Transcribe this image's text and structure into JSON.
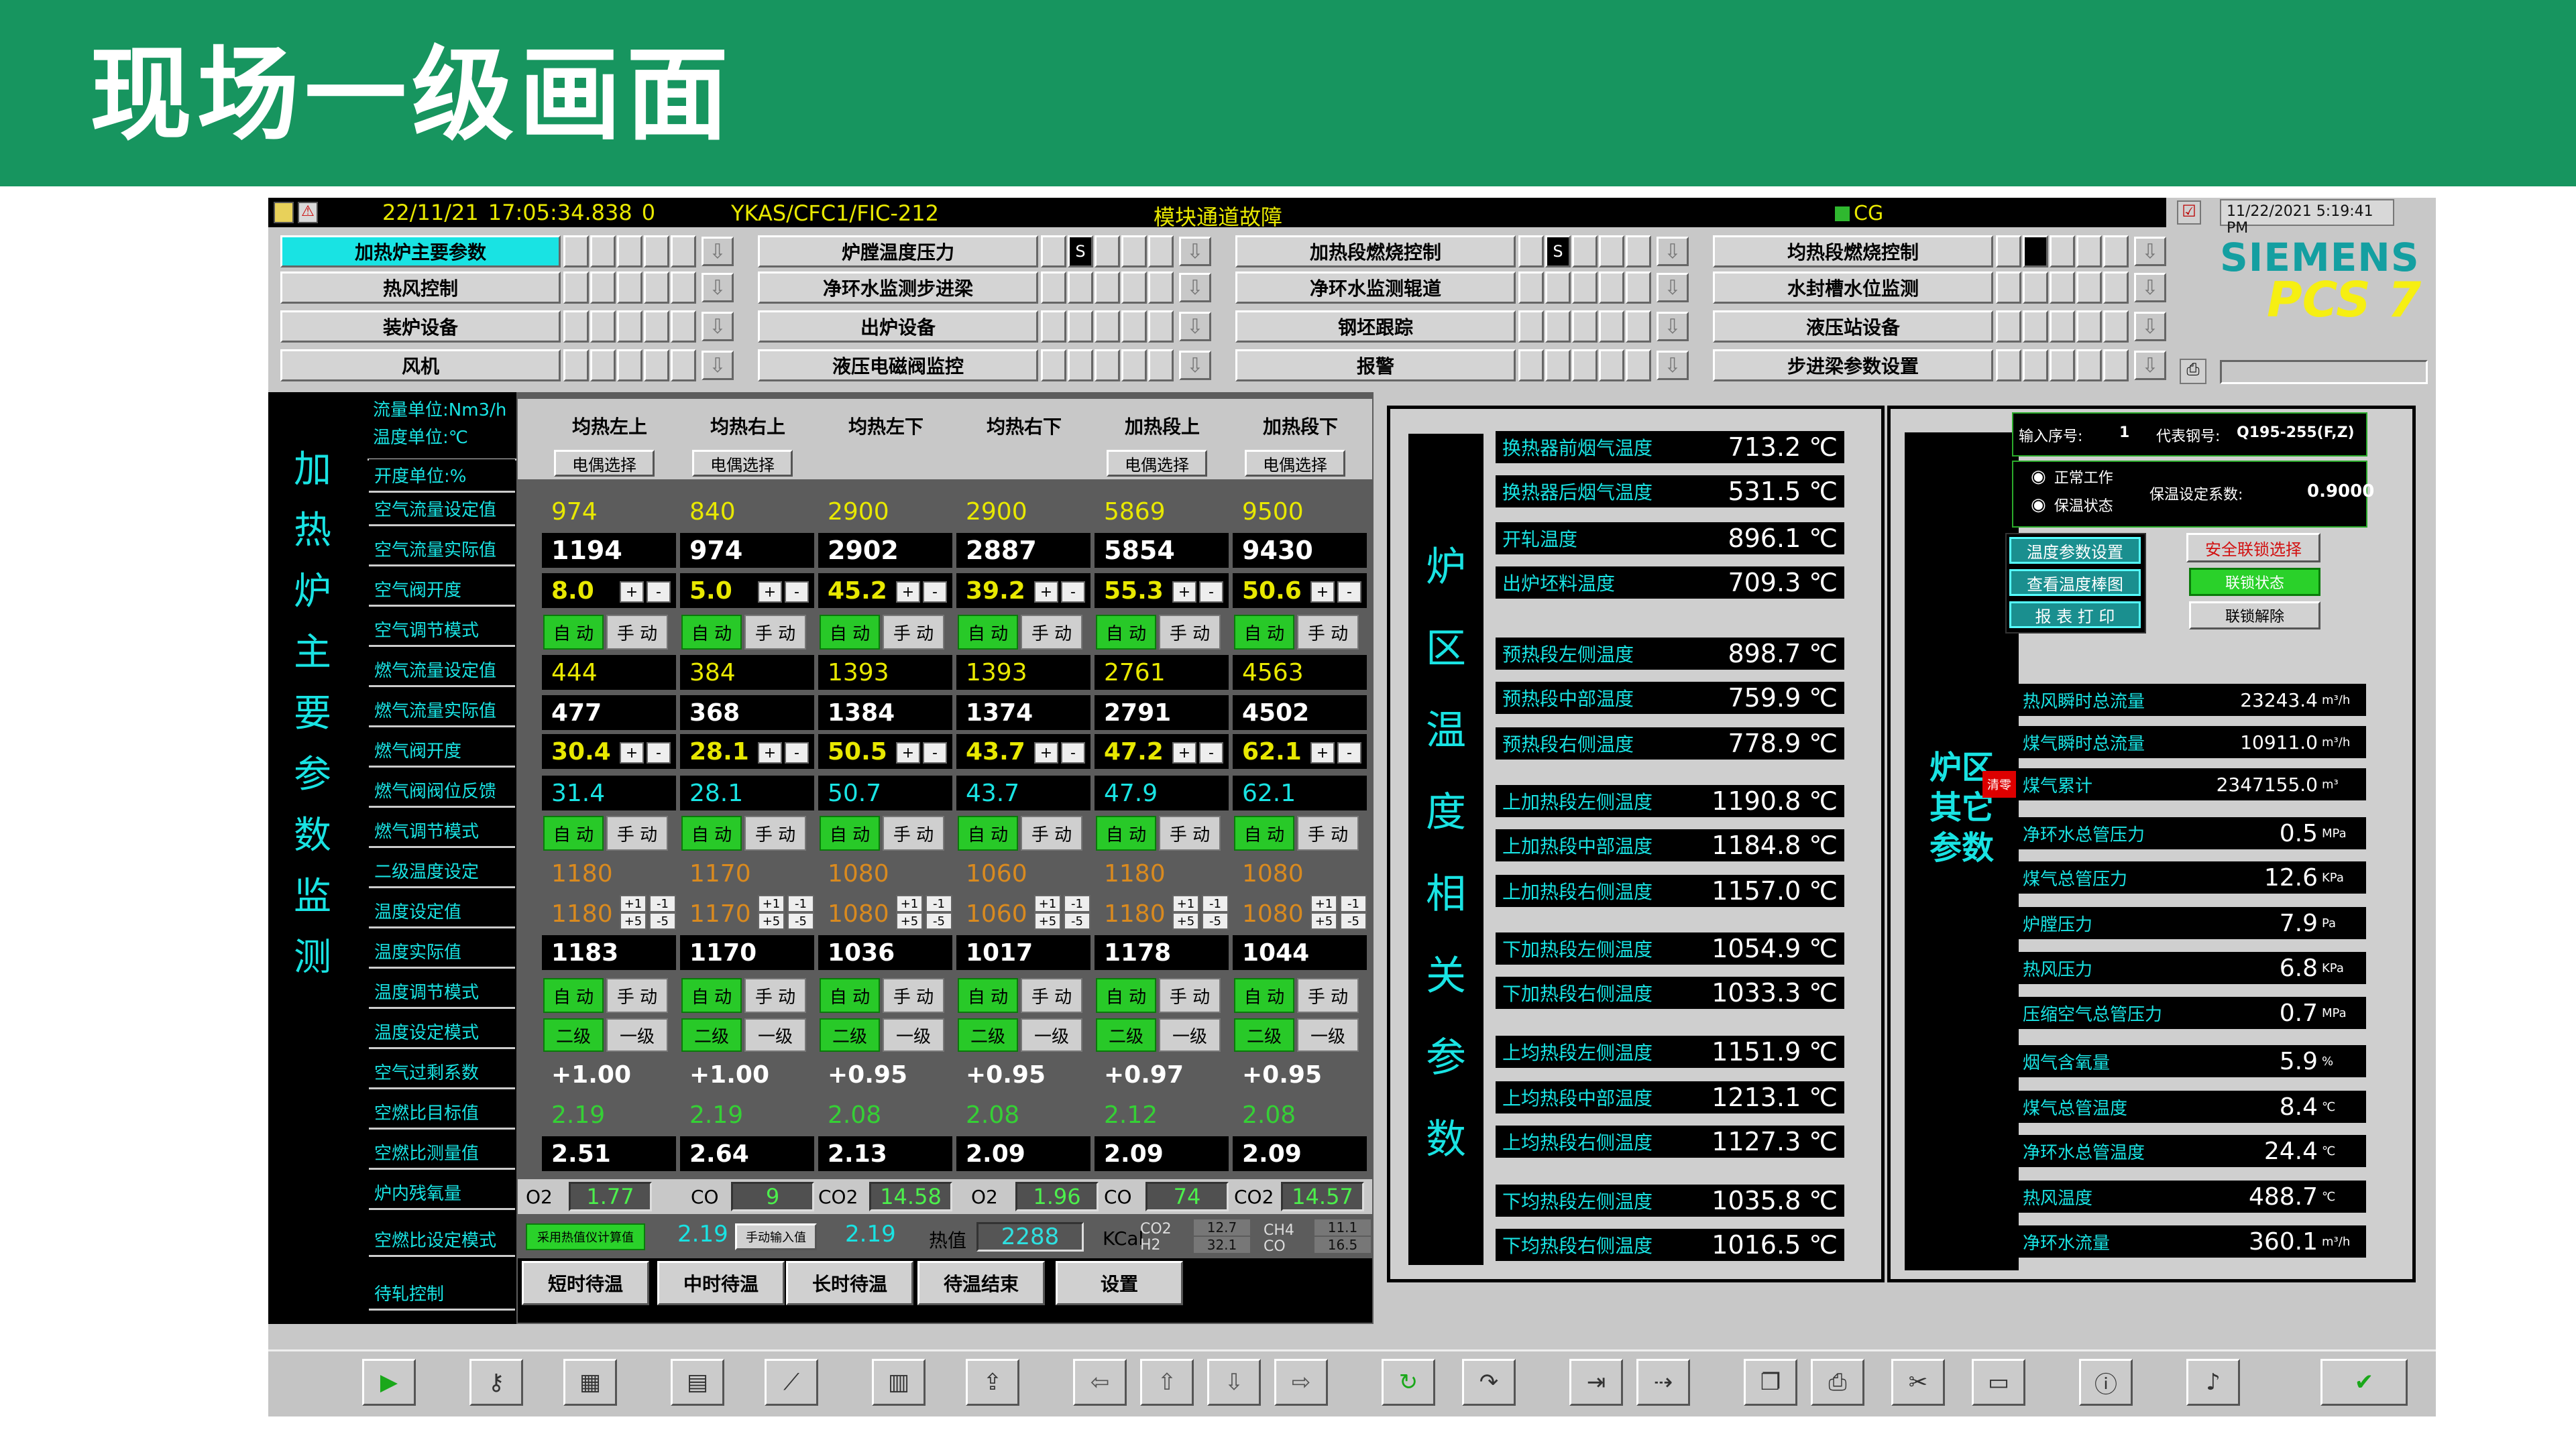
{
  "slide": {
    "title": "现场一级画面"
  },
  "topbar": {
    "date": "22/11/21",
    "time": "17:05:34.838",
    "count": "0",
    "tag": "YKAS/CFC1/FIC-212",
    "alarm_text": "模块通道故障",
    "cg": "CG",
    "clock": "11/22/2021 5:19:41 PM",
    "brand": "SIEMENS",
    "product": "PCS 7"
  },
  "nav": {
    "row1": [
      "加热炉主要参数",
      "炉膛温度压力",
      "加热段燃烧控制",
      "均热段燃烧控制"
    ],
    "row2": [
      "热风控制",
      "净环水监测步进梁",
      "净环水监测辊道",
      "水封槽水位监测"
    ],
    "row3": [
      "装炉设备",
      "出炉设备",
      "钢坯跟踪",
      "液压站设备"
    ],
    "row4": [
      "风机",
      "液压电磁阀监控",
      "报警",
      "步进梁参数设置"
    ],
    "s_marker": "S"
  },
  "left_panel": {
    "vertical_title": "加热炉主要参数监测",
    "units": [
      "流量单位:Nm3/h",
      "温度单位:℃",
      "开度单位:%"
    ],
    "labels": [
      "空气流量设定值",
      "空气流量实际值",
      "空气阀开度",
      "空气调节模式",
      "燃气流量设定值",
      "燃气流量实际值",
      "燃气阀开度",
      "燃气阀阀位反馈",
      "燃气调节模式",
      "二级温度设定",
      "温度设定值",
      "温度实际值",
      "温度调节模式",
      "温度设定模式",
      "空气过剩系数",
      "空燃比目标值",
      "空燃比测量值",
      "炉内残氧量",
      "空燃比设定模式",
      "待轧控制"
    ],
    "zones": [
      "均热左上",
      "均热右上",
      "均热左下",
      "均热右下",
      "加热段上",
      "加热段下"
    ],
    "tc_btn": "电偶选择",
    "air_set": [
      "974",
      "840",
      "2900",
      "2900",
      "5869",
      "9500"
    ],
    "air_act": [
      "1194",
      "974",
      "2902",
      "2887",
      "5854",
      "9430"
    ],
    "air_valve": [
      "8.0",
      "5.0",
      "45.2",
      "39.2",
      "55.3",
      "50.6"
    ],
    "gas_set": [
      "444",
      "384",
      "1393",
      "1393",
      "2761",
      "4563"
    ],
    "gas_act": [
      "477",
      "368",
      "1384",
      "1374",
      "2791",
      "4502"
    ],
    "gas_valve": [
      "30.4",
      "28.1",
      "50.5",
      "43.7",
      "47.2",
      "62.1"
    ],
    "gas_fb": [
      "31.4",
      "28.1",
      "50.7",
      "43.7",
      "47.9",
      "62.1"
    ],
    "lvl2_set": [
      "1180",
      "1170",
      "1080",
      "1060",
      "1180",
      "1080"
    ],
    "temp_set": [
      "1180",
      "1170",
      "1080",
      "1060",
      "1180",
      "1080"
    ],
    "temp_act": [
      "1183",
      "1170",
      "1036",
      "1017",
      "1178",
      "1044"
    ],
    "excess_air": [
      "+1.00",
      "+1.00",
      "+0.95",
      "+0.95",
      "+0.97",
      "+0.95"
    ],
    "ratio_target": [
      "2.19",
      "2.19",
      "2.08",
      "2.08",
      "2.12",
      "2.08"
    ],
    "ratio_meas": [
      "2.51",
      "2.64",
      "2.13",
      "2.09",
      "2.09",
      "2.09"
    ],
    "auto": "自 动",
    "manual": "手 动",
    "lvl2": "二级",
    "lvl1": "一级",
    "plus": "+",
    "minus": "-",
    "step_p1": "+1",
    "step_m1": "-1",
    "step_p5": "+5",
    "step_m5": "-5",
    "o2_label": "O2",
    "co_label": "CO",
    "co2_label": "CO2",
    "o2_a": "1.77",
    "co_a": "9",
    "co2_a": "14.58",
    "o2_b": "1.96",
    "co_b": "74",
    "co2_b": "14.57",
    "calc_btn": "采用热值仪计算值",
    "calc_val": "2.19",
    "manual_input_btn": "手动输入值",
    "manual_val": "2.19",
    "heat_label": "热值",
    "heat_val": "2288",
    "heat_unit": "KCal",
    "co2_small": "CO2",
    "h2_small": "H2",
    "ch4_small": "CH4",
    "co_small": "CO",
    "co2_s": "12.7",
    "h2_s": "32.1",
    "ch4_s": "11.1",
    "co_s": "16.5",
    "wait_btns": [
      "短时待温",
      "中时待温",
      "长时待温",
      "待温结束",
      "设置"
    ]
  },
  "temp_panel": {
    "vertical_title": "炉区温度相关参数",
    "rows": [
      {
        "label": "换热器前烟气温度",
        "value": "713.2 ℃"
      },
      {
        "label": "换热器后烟气温度",
        "value": "531.5 ℃"
      },
      {
        "label": "开轧温度",
        "value": "896.1 ℃"
      },
      {
        "label": "出炉坯料温度",
        "value": "709.3 ℃"
      },
      {
        "label": "预热段左侧温度",
        "value": "898.7 ℃"
      },
      {
        "label": "预热段中部温度",
        "value": "759.9 ℃"
      },
      {
        "label": "预热段右侧温度",
        "value": "778.9 ℃"
      },
      {
        "label": "上加热段左侧温度",
        "value": "1190.8 ℃"
      },
      {
        "label": "上加热段中部温度",
        "value": "1184.8 ℃"
      },
      {
        "label": "上加热段右侧温度",
        "value": "1157.0 ℃"
      },
      {
        "label": "下加热段左侧温度",
        "value": "1054.9 ℃"
      },
      {
        "label": "下加热段右侧温度",
        "value": "1033.3 ℃"
      },
      {
        "label": "上均热段左侧温度",
        "value": "1151.9 ℃"
      },
      {
        "label": "上均热段中部温度",
        "value": "1213.1 ℃"
      },
      {
        "label": "上均热段右侧温度",
        "value": "1127.3 ℃"
      },
      {
        "label": "下均热段左侧温度",
        "value": "1035.8 ℃"
      },
      {
        "label": "下均热段右侧温度",
        "value": "1016.5 ℃"
      }
    ]
  },
  "other_panel": {
    "vertical_title": "炉区其它参数",
    "seq_label": "输入序号:",
    "seq_val": "1",
    "steel_label": "代表钢号:",
    "steel_val": "Q195-255(F,Z)",
    "normal": "正常工作",
    "hold": "保温状态",
    "coef_label": "保温设定系数:",
    "coef_val": "0.9000",
    "btn_temp_param": "温度参数设置",
    "btn_temp_bar": "查看温度棒图",
    "btn_report": "报 表 打 印",
    "btn_safety": "安全联锁选择",
    "btn_lock_state": "联锁状态",
    "btn_unlock": "联锁解除",
    "reset": "清零",
    "rows": [
      {
        "label": "热风瞬时总流量",
        "value": "23243.4",
        "unit": "m³/h"
      },
      {
        "label": "煤气瞬时总流量",
        "value": "10911.0",
        "unit": "m³/h"
      },
      {
        "label": "煤气累计",
        "value": "2347155.0",
        "unit": "m³"
      },
      {
        "label": "净环水总管压力",
        "value": "0.5",
        "unit": "MPa"
      },
      {
        "label": "煤气总管压力",
        "value": "12.6",
        "unit": "KPa"
      },
      {
        "label": "炉膛压力",
        "value": "7.9",
        "unit": "Pa"
      },
      {
        "label": "热风压力",
        "value": "6.8",
        "unit": "KPa"
      },
      {
        "label": "压缩空气总管压力",
        "value": "0.7",
        "unit": "MPa"
      },
      {
        "label": "烟气含氧量",
        "value": "5.9",
        "unit": "%"
      },
      {
        "label": "煤气总管温度",
        "value": "8.4",
        "unit": "℃"
      },
      {
        "label": "净环水总管温度",
        "value": "24.4",
        "unit": "℃"
      },
      {
        "label": "热风温度",
        "value": "488.7",
        "unit": "℃"
      },
      {
        "label": "净环水流量",
        "value": "360.1",
        "unit": "m³/h"
      }
    ]
  },
  "toolbar": {
    "icons": [
      "play-icon",
      "key-icon",
      "overview-icon",
      "report-icon",
      "trend-icon",
      "calendar-icon",
      "export-icon",
      "arrow-left-icon",
      "arrow-up-icon",
      "arrow-down-icon",
      "arrow-right-icon",
      "refresh-icon",
      "redo-icon",
      "login-icon",
      "forward-icon",
      "copy-icon",
      "print-icon",
      "delete-icon",
      "monitor-icon",
      "info-icon",
      "sound-icon",
      "ack-icon"
    ],
    "glyphs": [
      "▶",
      "⚷",
      "▦",
      "▤",
      "⟋",
      "▥",
      "⇪",
      "⇦",
      "⇧",
      "⇩",
      "⇨",
      "↻",
      "↷",
      "⇥",
      "⇢",
      "❐",
      "⎙",
      "✂",
      "▭",
      "ⓘ",
      "♪",
      "✔"
    ]
  }
}
